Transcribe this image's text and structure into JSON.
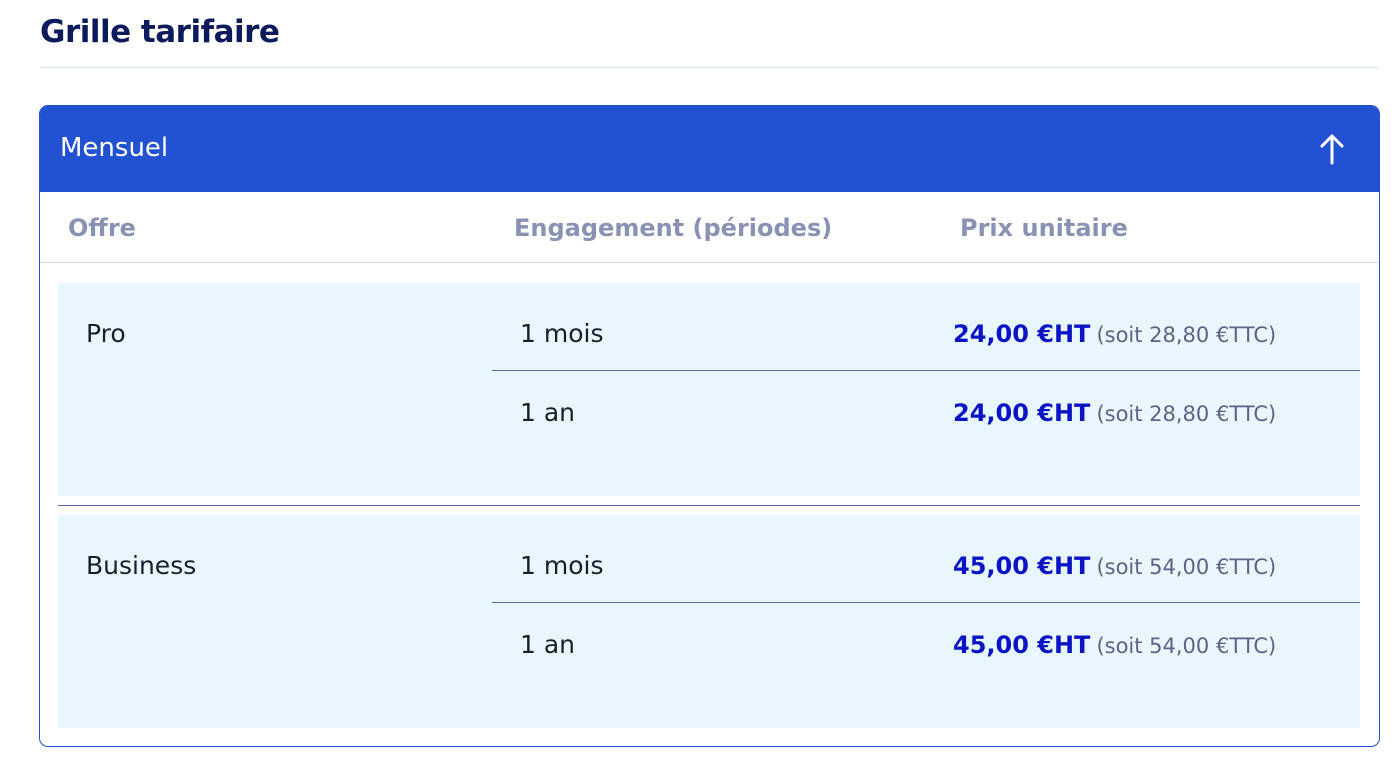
{
  "page": {
    "title": "Grille tarifaire"
  },
  "accordion": {
    "title": "Mensuel",
    "toggle_icon": "arrow-up-icon",
    "colors": {
      "header_bg": "#2251d1",
      "row_bg": "#e8f7fd",
      "price_color": "#0a14c4"
    }
  },
  "table": {
    "columns": [
      "Offre",
      "Engagement (périodes)",
      "Prix unitaire"
    ],
    "offers": [
      {
        "name": "Pro",
        "periods": [
          {
            "label": "1 mois",
            "price_ht": "24,00 €HT",
            "price_ttc": "(soit 28,80 €TTC)"
          },
          {
            "label": "1 an",
            "price_ht": "24,00 €HT",
            "price_ttc": "(soit 28,80 €TTC)"
          }
        ]
      },
      {
        "name": "Business",
        "periods": [
          {
            "label": "1 mois",
            "price_ht": "45,00 €HT",
            "price_ttc": "(soit 54,00 €TTC)"
          },
          {
            "label": "1 an",
            "price_ht": "45,00 €HT",
            "price_ttc": "(soit 54,00 €TTC)"
          }
        ]
      }
    ]
  }
}
